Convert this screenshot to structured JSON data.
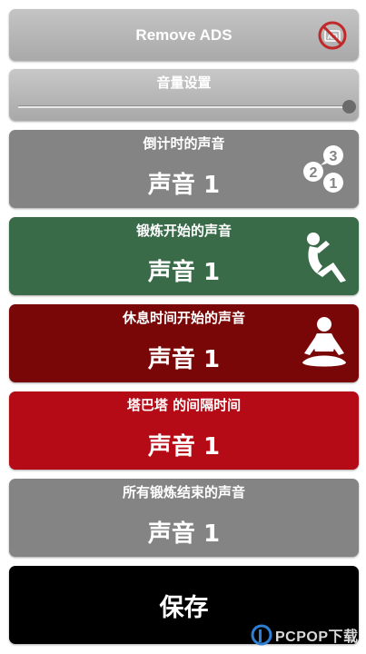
{
  "remove_ads": {
    "label": "Remove ADS",
    "icon": "no-ads-icon"
  },
  "volume": {
    "title": "音量设置",
    "level": 1.0
  },
  "sounds": [
    {
      "label": "倒计时的声音",
      "value": "声音 1",
      "color": "#848484",
      "icon": "countdown-numbers-icon"
    },
    {
      "label": "锻炼开始的声音",
      "value": "声音 1",
      "color": "#396b49",
      "icon": "sit-up-exercise-icon"
    },
    {
      "label": "休息时间开始的声音",
      "value": "声音 1",
      "color": "#7a0707",
      "icon": "meditation-rest-icon"
    },
    {
      "label": "塔巴塔 的间隔时间",
      "value": "声音 1",
      "color": "#b50b16"
    },
    {
      "label": "所有锻炼结束的声音",
      "value": "声音 1",
      "color": "#848484"
    }
  ],
  "save": {
    "label": "保存"
  },
  "watermark": {
    "text": "PCPOP下载"
  }
}
